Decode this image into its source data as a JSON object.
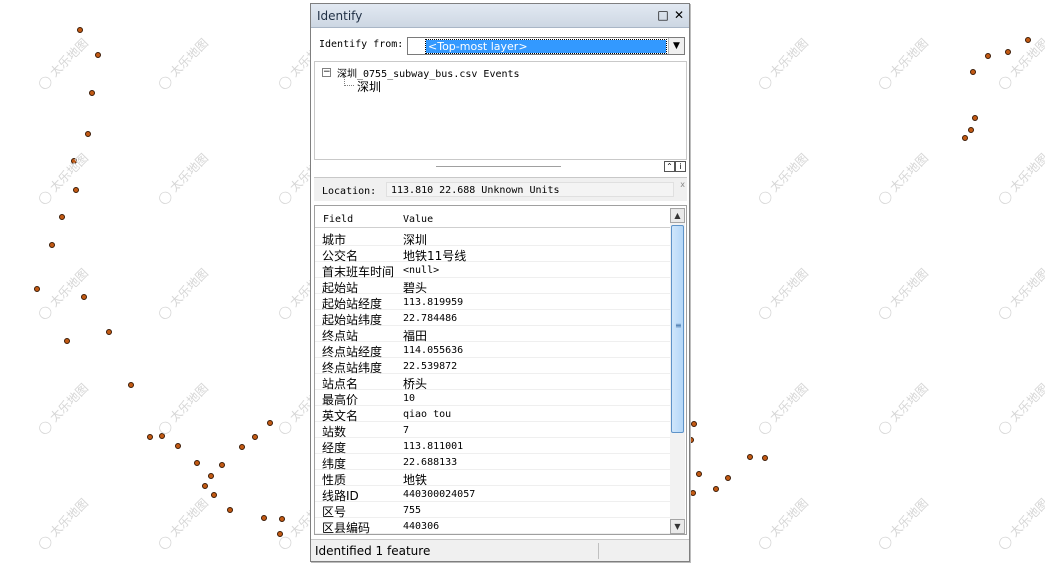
{
  "window": {
    "title": "Identify",
    "maximize_icon": "□",
    "close_icon": "✕"
  },
  "identify_from": {
    "label": "Identify from:",
    "selected": "<Top-most layer>",
    "arrow": "▼"
  },
  "tree": {
    "expand_glyph": "−",
    "root_label": "深圳_0755_subway_bus.csv Events",
    "child_label": "深圳"
  },
  "splitter_buttons": {
    "collapse": "⌃",
    "info": "i"
  },
  "location": {
    "label": "Location:",
    "value": "113.810  22.688 Unknown Units",
    "close_glyph": "x"
  },
  "grid": {
    "header_field": "Field",
    "header_value": "Value",
    "rows": [
      {
        "field": "城市",
        "value": "深圳"
      },
      {
        "field": "公交名",
        "value": "地铁11号线"
      },
      {
        "field": "首末班车时间",
        "value": "<null>"
      },
      {
        "field": "起始站",
        "value": "碧头"
      },
      {
        "field": "起始站经度",
        "value": "113.819959"
      },
      {
        "field": "起始站纬度",
        "value": "22.784486"
      },
      {
        "field": "终点站",
        "value": "福田"
      },
      {
        "field": "终点站经度",
        "value": "114.055636"
      },
      {
        "field": "终点站纬度",
        "value": "22.539872"
      },
      {
        "field": "站点名",
        "value": "桥头"
      },
      {
        "field": "最高价",
        "value": "10"
      },
      {
        "field": "英文名",
        "value": "qiao tou"
      },
      {
        "field": "站数",
        "value": "7"
      },
      {
        "field": "经度",
        "value": "113.811001"
      },
      {
        "field": "纬度",
        "value": "22.688133"
      },
      {
        "field": "性质",
        "value": "地铁"
      },
      {
        "field": "线路ID",
        "value": "440300024057"
      },
      {
        "field": "区号",
        "value": "755"
      },
      {
        "field": "区县编码",
        "value": "440306"
      }
    ],
    "scroll_up": "▲",
    "scroll_down": "▼",
    "scroll_grip": "≡"
  },
  "status": {
    "text": "Identified 1 feature"
  },
  "watermark": "太乐地图",
  "colors": {
    "point_fill": "#c25a14",
    "selection": "#3399ff",
    "titlebar": "#d6dfea"
  }
}
